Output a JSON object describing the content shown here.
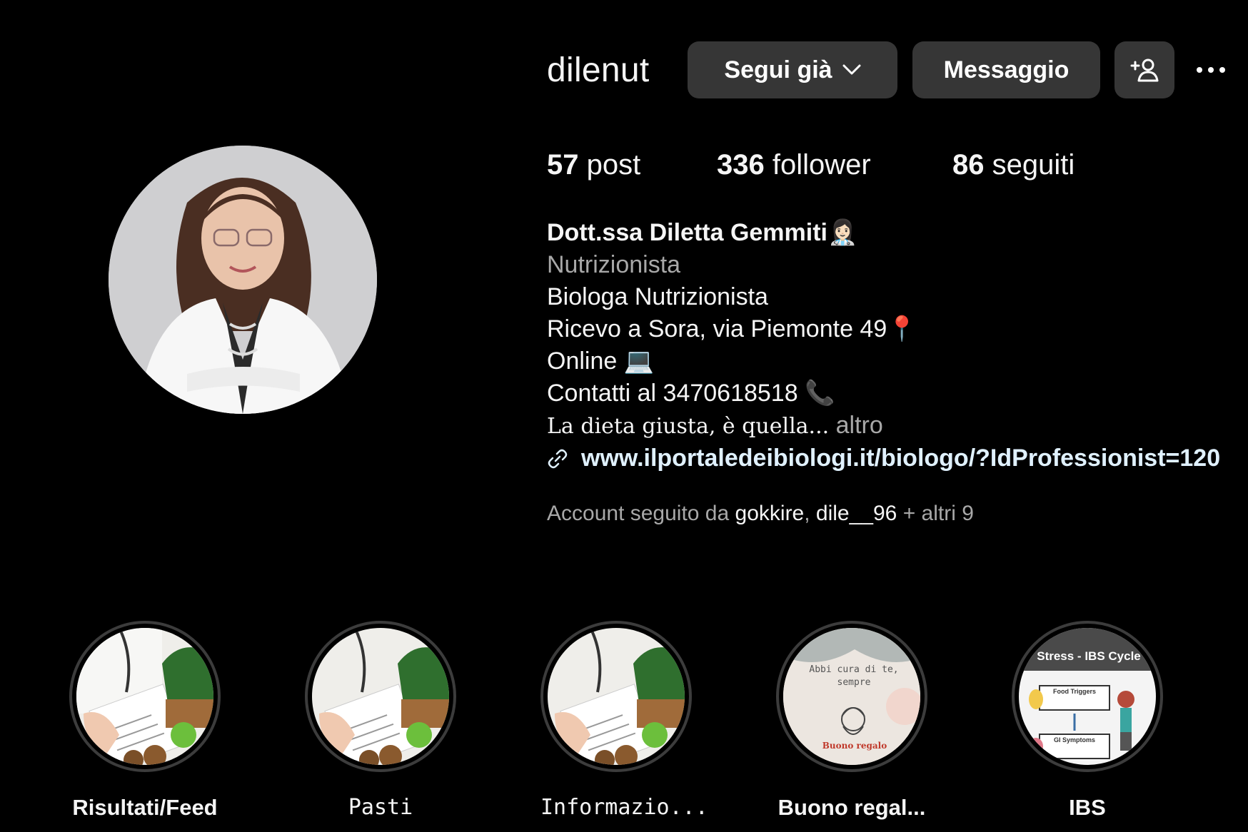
{
  "profile": {
    "username": "dilenut",
    "avatar_icon": "profile-photo"
  },
  "actions": {
    "follow_label": "Segui già",
    "message_label": "Messaggio",
    "add_user_icon": "person-plus-icon",
    "more_icon": "more-icon"
  },
  "stats": [
    {
      "value": "57",
      "label": "post"
    },
    {
      "value": "336",
      "label": "follower"
    },
    {
      "value": "86",
      "label": "seguiti"
    }
  ],
  "bio": {
    "name": "Dott.ssa Diletta Gemmiti👩🏻‍⚕️",
    "category": "Nutrizionista",
    "lines": [
      "Biologa Nutrizionista",
      "Ricevo a Sora, via Piemonte 49📍",
      "Online 💻",
      "Contatti al 3470618518 📞"
    ],
    "teaser": "La dieta giusta, è quella...",
    "more_label": "altro",
    "link": "www.ilportaledeibiologi.it/biologo/?IdProfessionist=120"
  },
  "followed_by": {
    "prefix": "Account seguito da",
    "user1": "gokkire",
    "user2": "dile__96",
    "suffix": "+ altri 9"
  },
  "highlights": [
    {
      "label": "Risultati/Feed"
    },
    {
      "label": "Pasti"
    },
    {
      "label": "Informazio..."
    },
    {
      "label": "Buono regal...",
      "overlay_text": "Abbi cura di te, sempre",
      "overlay_footer": "Buono regalo"
    },
    {
      "label": "IBS",
      "overlay_title": "Stress - IBS Cycle",
      "overlay_box1": "Food Triggers",
      "overlay_box2": "GI Symptoms"
    }
  ],
  "colors": {
    "background": "#000000",
    "button_bg": "#363636",
    "muted_text": "#a8a8a8",
    "link_text": "#e0f1ff"
  }
}
